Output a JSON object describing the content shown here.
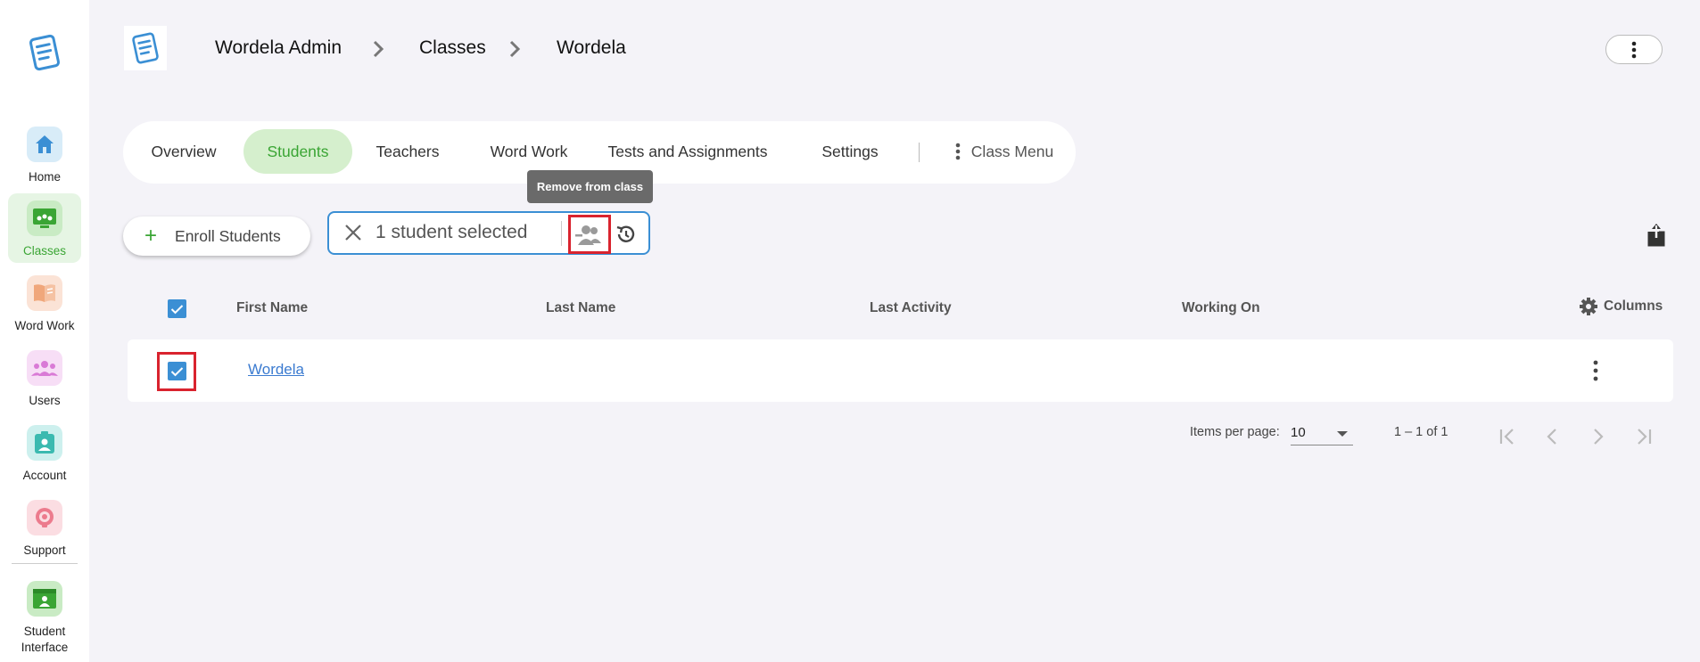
{
  "sidebar": {
    "items": [
      {
        "label": "Home",
        "icon": "home-icon"
      },
      {
        "label": "Classes",
        "icon": "classes-icon",
        "active": true
      },
      {
        "label": "Word Work",
        "icon": "book-icon"
      },
      {
        "label": "Users",
        "icon": "users-icon"
      },
      {
        "label": "Account",
        "icon": "account-badge-icon"
      },
      {
        "label": "Support",
        "icon": "support-icon"
      },
      {
        "label": "Student Interface",
        "icon": "student-interface-icon"
      }
    ]
  },
  "breadcrumb": {
    "items": [
      "Wordela Admin",
      "Classes",
      "Wordela"
    ]
  },
  "tabs": {
    "items": [
      "Overview",
      "Students",
      "Teachers",
      "Word Work",
      "Tests and Assignments",
      "Settings"
    ],
    "active": "Students",
    "class_menu": "Class Menu"
  },
  "tooltip": {
    "text": "Remove from class"
  },
  "actions": {
    "enroll_plus": "+",
    "enroll_label": "Enroll Students",
    "selection_text": "1 student selected"
  },
  "table": {
    "headers": [
      "First Name",
      "Last Name",
      "Last Activity",
      "Working On"
    ],
    "columns_label": "Columns",
    "rows": [
      {
        "first_name": "Wordela",
        "last_name": "",
        "last_activity": "",
        "working_on": "",
        "selected": true
      }
    ]
  },
  "pagination": {
    "items_per_page_label": "Items per page:",
    "items_per_page_value": "10",
    "range": "1 – 1 of 1"
  },
  "colors": {
    "accent_green": "#3aa534",
    "accent_blue": "#3b8fd4",
    "highlight_red": "#d9232e"
  }
}
